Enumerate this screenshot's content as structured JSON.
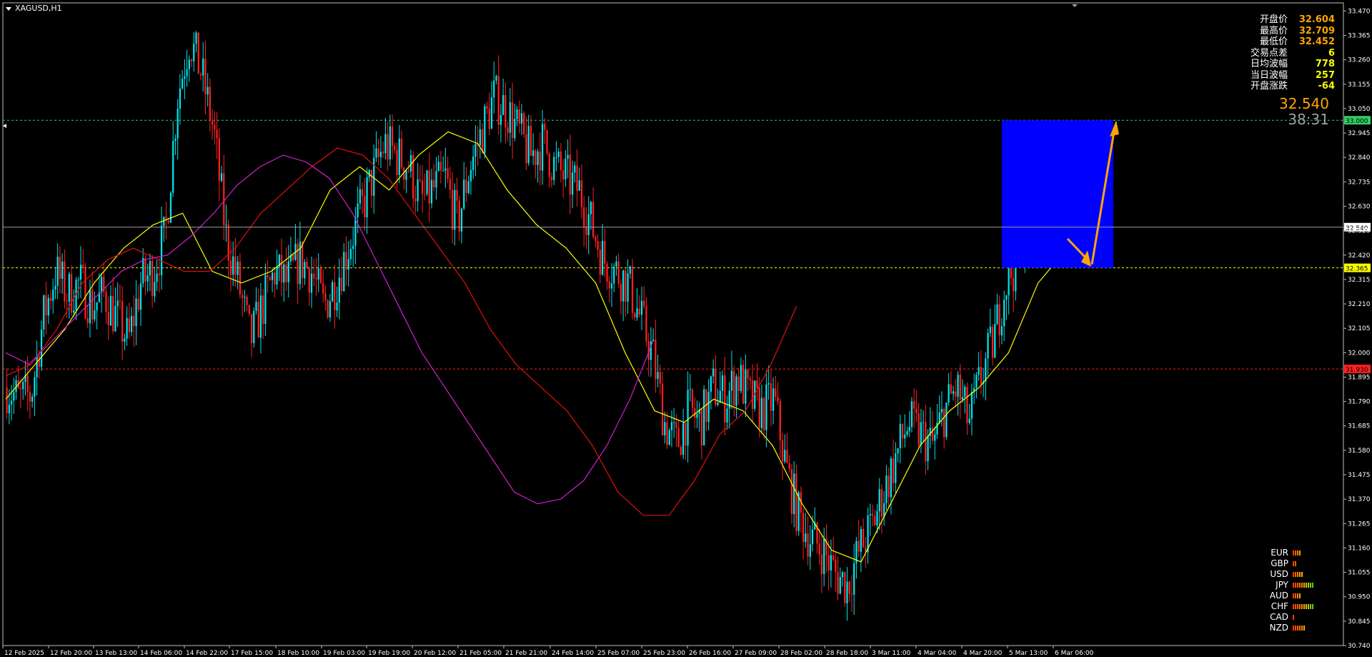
{
  "symbol_title": "XAGUSD,H1",
  "stats": [
    {
      "label": "开盘价",
      "value": "32.604",
      "color": "#ffa500"
    },
    {
      "label": "最高价",
      "value": "32.709",
      "color": "#ffa500"
    },
    {
      "label": "最低价",
      "value": "32.452",
      "color": "#ffa500"
    },
    {
      "label": "交易点差",
      "value": "6",
      "color": "#ffff00"
    },
    {
      "label": "日均波幅",
      "value": "778",
      "color": "#ffff00"
    },
    {
      "label": "当日波幅",
      "value": "257",
      "color": "#ffff00"
    },
    {
      "label": "开盘涨跌",
      "value": "-64",
      "color": "#ffff00"
    }
  ],
  "big_price": "32.540",
  "timer": "38:31",
  "strength": [
    {
      "currency": "EUR",
      "bars": 4,
      "colors": [
        "#ff4000",
        "#ff6000",
        "#ff8000",
        "#ffa000"
      ]
    },
    {
      "currency": "GBP",
      "bars": 2,
      "colors": [
        "#ff4000",
        "#ff6000"
      ]
    },
    {
      "currency": "USD",
      "bars": 5,
      "colors": [
        "#ff4000",
        "#ff6000",
        "#ff8000",
        "#ffa000",
        "#ffb000"
      ]
    },
    {
      "currency": "JPY",
      "bars": 10,
      "colors": [
        "#ff4000",
        "#ff5000",
        "#ff6000",
        "#ff7000",
        "#ff8000",
        "#ffa000",
        "#d0c000",
        "#a0d000",
        "#80d000",
        "#60d000"
      ]
    },
    {
      "currency": "AUD",
      "bars": 4,
      "colors": [
        "#ff4000",
        "#ff6000",
        "#ff8000",
        "#ffa000"
      ]
    },
    {
      "currency": "CHF",
      "bars": 10,
      "colors": [
        "#ff4000",
        "#ff5000",
        "#ff6000",
        "#ff7000",
        "#ff8000",
        "#ffa000",
        "#d0c000",
        "#a0d000",
        "#80d000",
        "#60d000"
      ]
    },
    {
      "currency": "CAD",
      "bars": 1,
      "colors": [
        "#ff4000"
      ]
    },
    {
      "currency": "NZD",
      "bars": 6,
      "colors": [
        "#ff4000",
        "#ff5000",
        "#ff6000",
        "#ff7000",
        "#ff8000",
        "#ffa000"
      ]
    }
  ],
  "chart_data": {
    "type": "candlestick",
    "symbol": "XAGUSD",
    "timeframe": "H1",
    "ylim": [
      30.74,
      33.505
    ],
    "y_ticks": [
      "33.470",
      "33.365",
      "33.260",
      "33.155",
      "33.050",
      "32.945",
      "32.840",
      "32.735",
      "32.630",
      "32.525",
      "32.420",
      "32.315",
      "32.210",
      "32.105",
      "32.000",
      "31.895",
      "31.790",
      "31.685",
      "31.580",
      "31.475",
      "31.370",
      "31.265",
      "31.160",
      "31.055",
      "30.950",
      "30.845",
      "30.740"
    ],
    "x_ticks": [
      "12 Feb 2025",
      "12 Feb 20:00",
      "13 Feb 13:00",
      "14 Feb 06:00",
      "14 Feb 22:00",
      "17 Feb 15:00",
      "18 Feb 10:00",
      "19 Feb 03:00",
      "19 Feb 19:00",
      "20 Feb 12:00",
      "21 Feb 05:00",
      "21 Feb 21:00",
      "24 Feb 14:00",
      "25 Feb 07:00",
      "25 Feb 23:00",
      "26 Feb 16:00",
      "27 Feb 09:00",
      "28 Feb 02:00",
      "28 Feb 18:00",
      "3 Mar 11:00",
      "4 Mar 04:00",
      "4 Mar 20:00",
      "5 Mar 13:00",
      "6 Mar 06:00"
    ],
    "current_price": 32.54,
    "current_price_label": "32.540",
    "levels": [
      {
        "price": 33.0,
        "label": "33.000",
        "color": "#33cc66"
      },
      {
        "price": 32.365,
        "label": "32.365",
        "color": "#ffff00"
      },
      {
        "price": 31.93,
        "label": "31.930",
        "color": "#ff2020"
      }
    ],
    "close_path": [
      31.85,
      31.8,
      31.82,
      32.15,
      32.35,
      32.25,
      32.3,
      32.2,
      32.25,
      32.15,
      32.05,
      32.3,
      32.35,
      32.5,
      33.1,
      33.35,
      33.2,
      32.95,
      32.5,
      32.3,
      32.05,
      32.2,
      32.35,
      32.3,
      32.4,
      32.35,
      32.2,
      32.3,
      32.45,
      32.6,
      32.75,
      32.9,
      32.85,
      32.8,
      32.65,
      32.7,
      32.75,
      32.55,
      32.8,
      32.95,
      33.1,
      33.05,
      32.95,
      32.85,
      32.9,
      32.8,
      32.75,
      32.7,
      32.55,
      32.4,
      32.35,
      32.3,
      32.15,
      32.0,
      31.7,
      31.6,
      31.75,
      31.7,
      31.85,
      31.8,
      31.9,
      31.8,
      31.75,
      31.8,
      31.5,
      31.3,
      31.2,
      31.15,
      31.05,
      31.0,
      31.15,
      31.25,
      31.4,
      31.55,
      31.7,
      31.65,
      31.6,
      31.75,
      31.85,
      31.7,
      31.9,
      32.05,
      32.3,
      32.4,
      32.65,
      32.7,
      32.6,
      32.55
    ],
    "candle_count": 460,
    "ma_series": [
      {
        "color": "#ffff00",
        "values": [
          31.8,
          31.95,
          32.1,
          32.3,
          32.45,
          32.55,
          32.6,
          32.35,
          32.3,
          32.35,
          32.45,
          32.7,
          32.8,
          32.7,
          32.85,
          32.95,
          32.9,
          32.7,
          32.55,
          32.45,
          32.3,
          32.0,
          31.75,
          31.7,
          31.8,
          31.75,
          31.6,
          31.35,
          31.15,
          31.1,
          31.35,
          31.6,
          31.75,
          31.85,
          32.0,
          32.3,
          32.45
        ]
      },
      {
        "color": "#e01010",
        "values": [
          31.9,
          31.95,
          32.1,
          32.3,
          32.4,
          32.45,
          32.4,
          32.35,
          32.35,
          32.45,
          32.6,
          32.7,
          32.8,
          32.88,
          32.85,
          32.75,
          32.6,
          32.45,
          32.3,
          32.1,
          31.95,
          31.85,
          31.75,
          31.6,
          31.4,
          31.3,
          31.3,
          31.45,
          31.65,
          31.75,
          31.95,
          32.2
        ]
      },
      {
        "color": "#d020d0",
        "values": [
          32.0,
          31.95,
          32.05,
          32.15,
          32.25,
          32.35,
          32.4,
          32.42,
          32.5,
          32.6,
          32.72,
          32.8,
          32.85,
          32.82,
          32.75,
          32.6,
          32.4,
          32.2,
          32.0,
          31.85,
          31.7,
          31.55,
          31.4,
          31.35,
          31.37,
          31.45,
          31.6,
          31.8,
          32.05
        ]
      }
    ]
  }
}
